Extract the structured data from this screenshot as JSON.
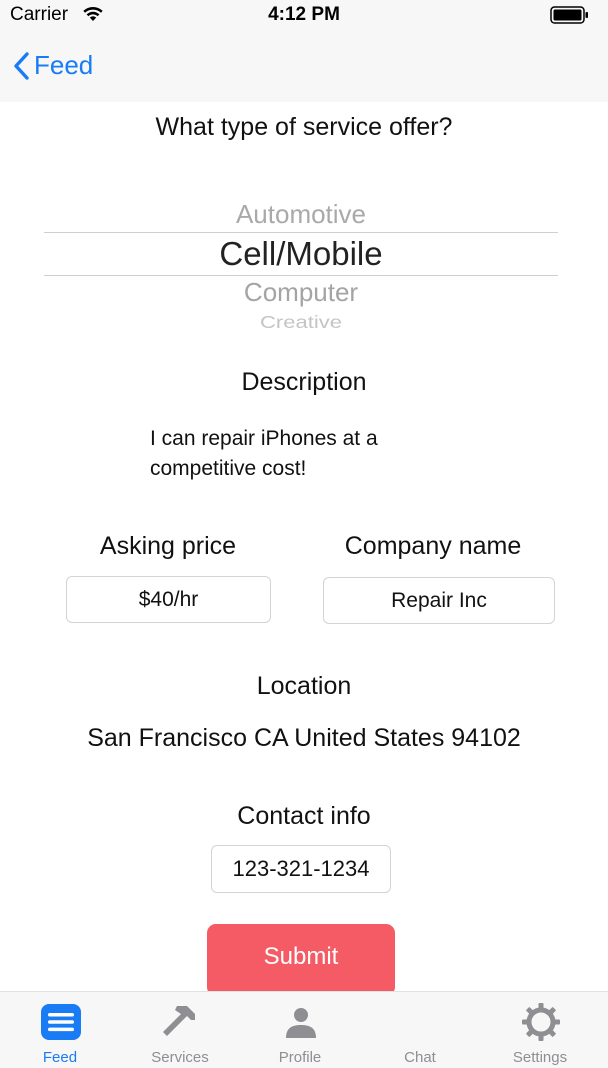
{
  "status_bar": {
    "carrier": "Carrier",
    "time": "4:12 PM"
  },
  "nav": {
    "back_label": "Feed"
  },
  "form": {
    "service_question": "What type of service offer?",
    "picker": {
      "options": [
        "Automotive",
        "Cell/Mobile",
        "Computer",
        "Creative"
      ],
      "selected": "Cell/Mobile"
    },
    "description": {
      "label": "Description",
      "value": "I can repair iPhones at a competitive cost!"
    },
    "asking_price": {
      "label": "Asking price",
      "value": "$40/hr"
    },
    "company_name": {
      "label": "Company name",
      "value": "Repair Inc"
    },
    "location": {
      "label": "Location",
      "value": "San Francisco CA United States 94102"
    },
    "contact_info": {
      "label": "Contact info",
      "value": "123-321-1234"
    },
    "submit_label": "Submit"
  },
  "colors": {
    "accent": "#1a7cf5",
    "submit": "#f45b64",
    "inactive_tab": "#8e8e93"
  },
  "tabs": [
    {
      "label": "Feed",
      "icon": "list-icon",
      "active": true
    },
    {
      "label": "Services",
      "icon": "hammer-icon",
      "active": false
    },
    {
      "label": "Profile",
      "icon": "person-icon",
      "active": false
    },
    {
      "label": "Chat",
      "icon": "chat-icon",
      "active": false
    },
    {
      "label": "Settings",
      "icon": "gear-icon",
      "active": false
    }
  ]
}
